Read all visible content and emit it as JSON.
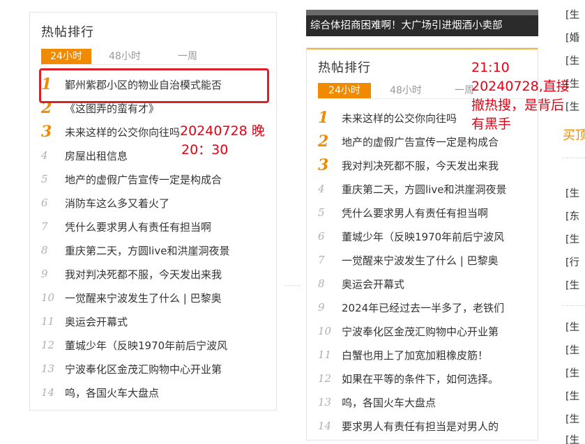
{
  "left_panel": {
    "title": "热帖排行",
    "tabs": [
      {
        "label": "24小时",
        "active": true
      },
      {
        "label": "48小时",
        "active": false
      },
      {
        "label": "一周",
        "active": false
      }
    ],
    "items": [
      {
        "rank": "1",
        "text": "鄞州紫郡小区的物业自治模式能否"
      },
      {
        "rank": "2",
        "text": "《这图弄的蛮有才》"
      },
      {
        "rank": "3",
        "text": "未来这样的公交你向往吗"
      },
      {
        "rank": "4",
        "text": "房屋出租信息"
      },
      {
        "rank": "5",
        "text": "地产的虚假广告宣传一定是构成合"
      },
      {
        "rank": "6",
        "text": "消防车这么多又着火了"
      },
      {
        "rank": "7",
        "text": "凭什么要求男人有责任有担当啊"
      },
      {
        "rank": "8",
        "text": "重庆第二天，方圆live和洪崖洞夜景"
      },
      {
        "rank": "9",
        "text": "我对判决死都不服，今天发出来我"
      },
      {
        "rank": "10",
        "text": "一觉醒来宁波发生了什么 | 巴黎奥"
      },
      {
        "rank": "11",
        "text": "奥运会开幕式"
      },
      {
        "rank": "12",
        "text": "董城少年（反映1970年前后宁波风"
      },
      {
        "rank": "13",
        "text": "宁波奉化区金茂汇购物中心开业第"
      },
      {
        "rank": "14",
        "text": "呜，各国火车大盘点"
      }
    ],
    "annotation": [
      "20240728 晚",
      "20：30"
    ]
  },
  "banner": {
    "text": "综合体招商困难啊！大广场引进烟酒小卖部"
  },
  "right_panel": {
    "title": "热帖排行",
    "tabs": [
      {
        "label": "24小时",
        "active": true
      },
      {
        "label": "48小时",
        "active": false
      },
      {
        "label": "一周",
        "active": false
      }
    ],
    "items": [
      {
        "rank": "1",
        "text": "未来这样的公交你向往吗"
      },
      {
        "rank": "2",
        "text": "地产的虚假广告宣传一定是构成合"
      },
      {
        "rank": "3",
        "text": "我对判决死都不服，今天发出来我"
      },
      {
        "rank": "4",
        "text": "重庆第二天，方圆live和洪崖洞夜景"
      },
      {
        "rank": "5",
        "text": "凭什么要求男人有责任有担当啊"
      },
      {
        "rank": "6",
        "text": "董城少年（反映1970年前后宁波风"
      },
      {
        "rank": "7",
        "text": "一觉醒来宁波发生了什么 | 巴黎奥"
      },
      {
        "rank": "8",
        "text": "奥运会开幕式"
      },
      {
        "rank": "9",
        "text": "2024年已经过去一半多了，老铁们"
      },
      {
        "rank": "10",
        "text": "宁波奉化区金茂汇购物中心开业第"
      },
      {
        "rank": "11",
        "text": "白蟹也用上了加宽加粗橡皮筋！"
      },
      {
        "rank": "12",
        "text": "如果在平等的条件下，如何选择。"
      },
      {
        "rank": "13",
        "text": "呜，各国火车大盘点"
      },
      {
        "rank": "14",
        "text": "要求男人有责任有担当是对男人的"
      }
    ],
    "annotation": [
      "21:10",
      "20240728,直接",
      "撤热搜，是背后",
      "有黑手"
    ]
  },
  "edge": {
    "items_top": [
      "[生",
      "[婚",
      "[生",
      "[生",
      "[生"
    ],
    "orange": "买顶",
    "items_mid": [
      "[生",
      "[东",
      "[生",
      "[行",
      "[生"
    ],
    "items_bottom": [
      "[生",
      "[生",
      "[生",
      "[生",
      "[生",
      "[生"
    ]
  },
  "colors": {
    "accent": "#f08a00",
    "annotation_red": "#e60012",
    "box_red": "#d7222a"
  }
}
